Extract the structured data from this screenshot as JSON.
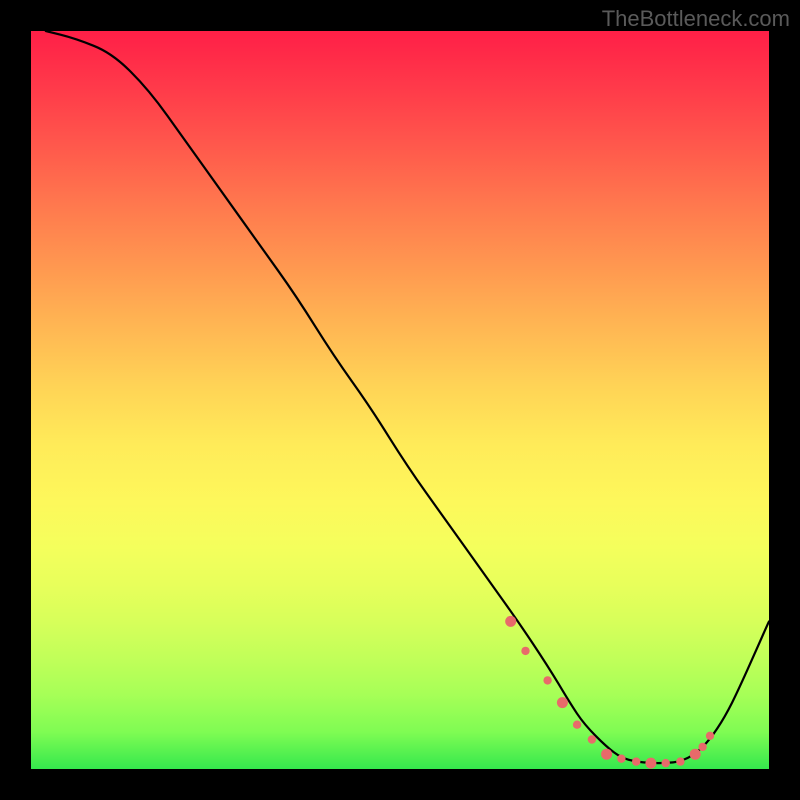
{
  "attribution": "TheBottleneck.com",
  "chart_data": {
    "type": "line",
    "title": "",
    "xlabel": "",
    "ylabel": "",
    "xlim": [
      0,
      100
    ],
    "ylim": [
      0,
      100
    ],
    "grid": false,
    "legend": false,
    "series": [
      {
        "name": "bottleneck-curve",
        "x": [
          2,
          6,
          11,
          16,
          21,
          26,
          31,
          36,
          41,
          46,
          51,
          56,
          61,
          66,
          70,
          73,
          75,
          78,
          80,
          82,
          84,
          86,
          88,
          90,
          92,
          94,
          96,
          100
        ],
        "y": [
          100,
          99,
          97,
          92,
          85,
          78,
          71,
          64,
          56,
          49,
          41,
          34,
          27,
          20,
          14,
          9,
          6,
          3,
          1.5,
          1,
          0.8,
          0.8,
          1,
          2,
          4,
          7,
          11,
          20
        ]
      }
    ],
    "markers": {
      "name": "threshold-dots",
      "x": [
        65,
        67,
        70,
        72,
        74,
        76,
        78,
        80,
        82,
        84,
        86,
        88,
        90,
        91,
        92
      ],
      "y": [
        20,
        16,
        12,
        9,
        6,
        4,
        2,
        1.4,
        1,
        0.8,
        0.8,
        1,
        2,
        3,
        4.5
      ]
    },
    "colors": {
      "curve": "#000000",
      "markers": "#e86a6a",
      "gradient_top": "#ff1f47",
      "gradient_bottom": "#35e84d"
    }
  }
}
